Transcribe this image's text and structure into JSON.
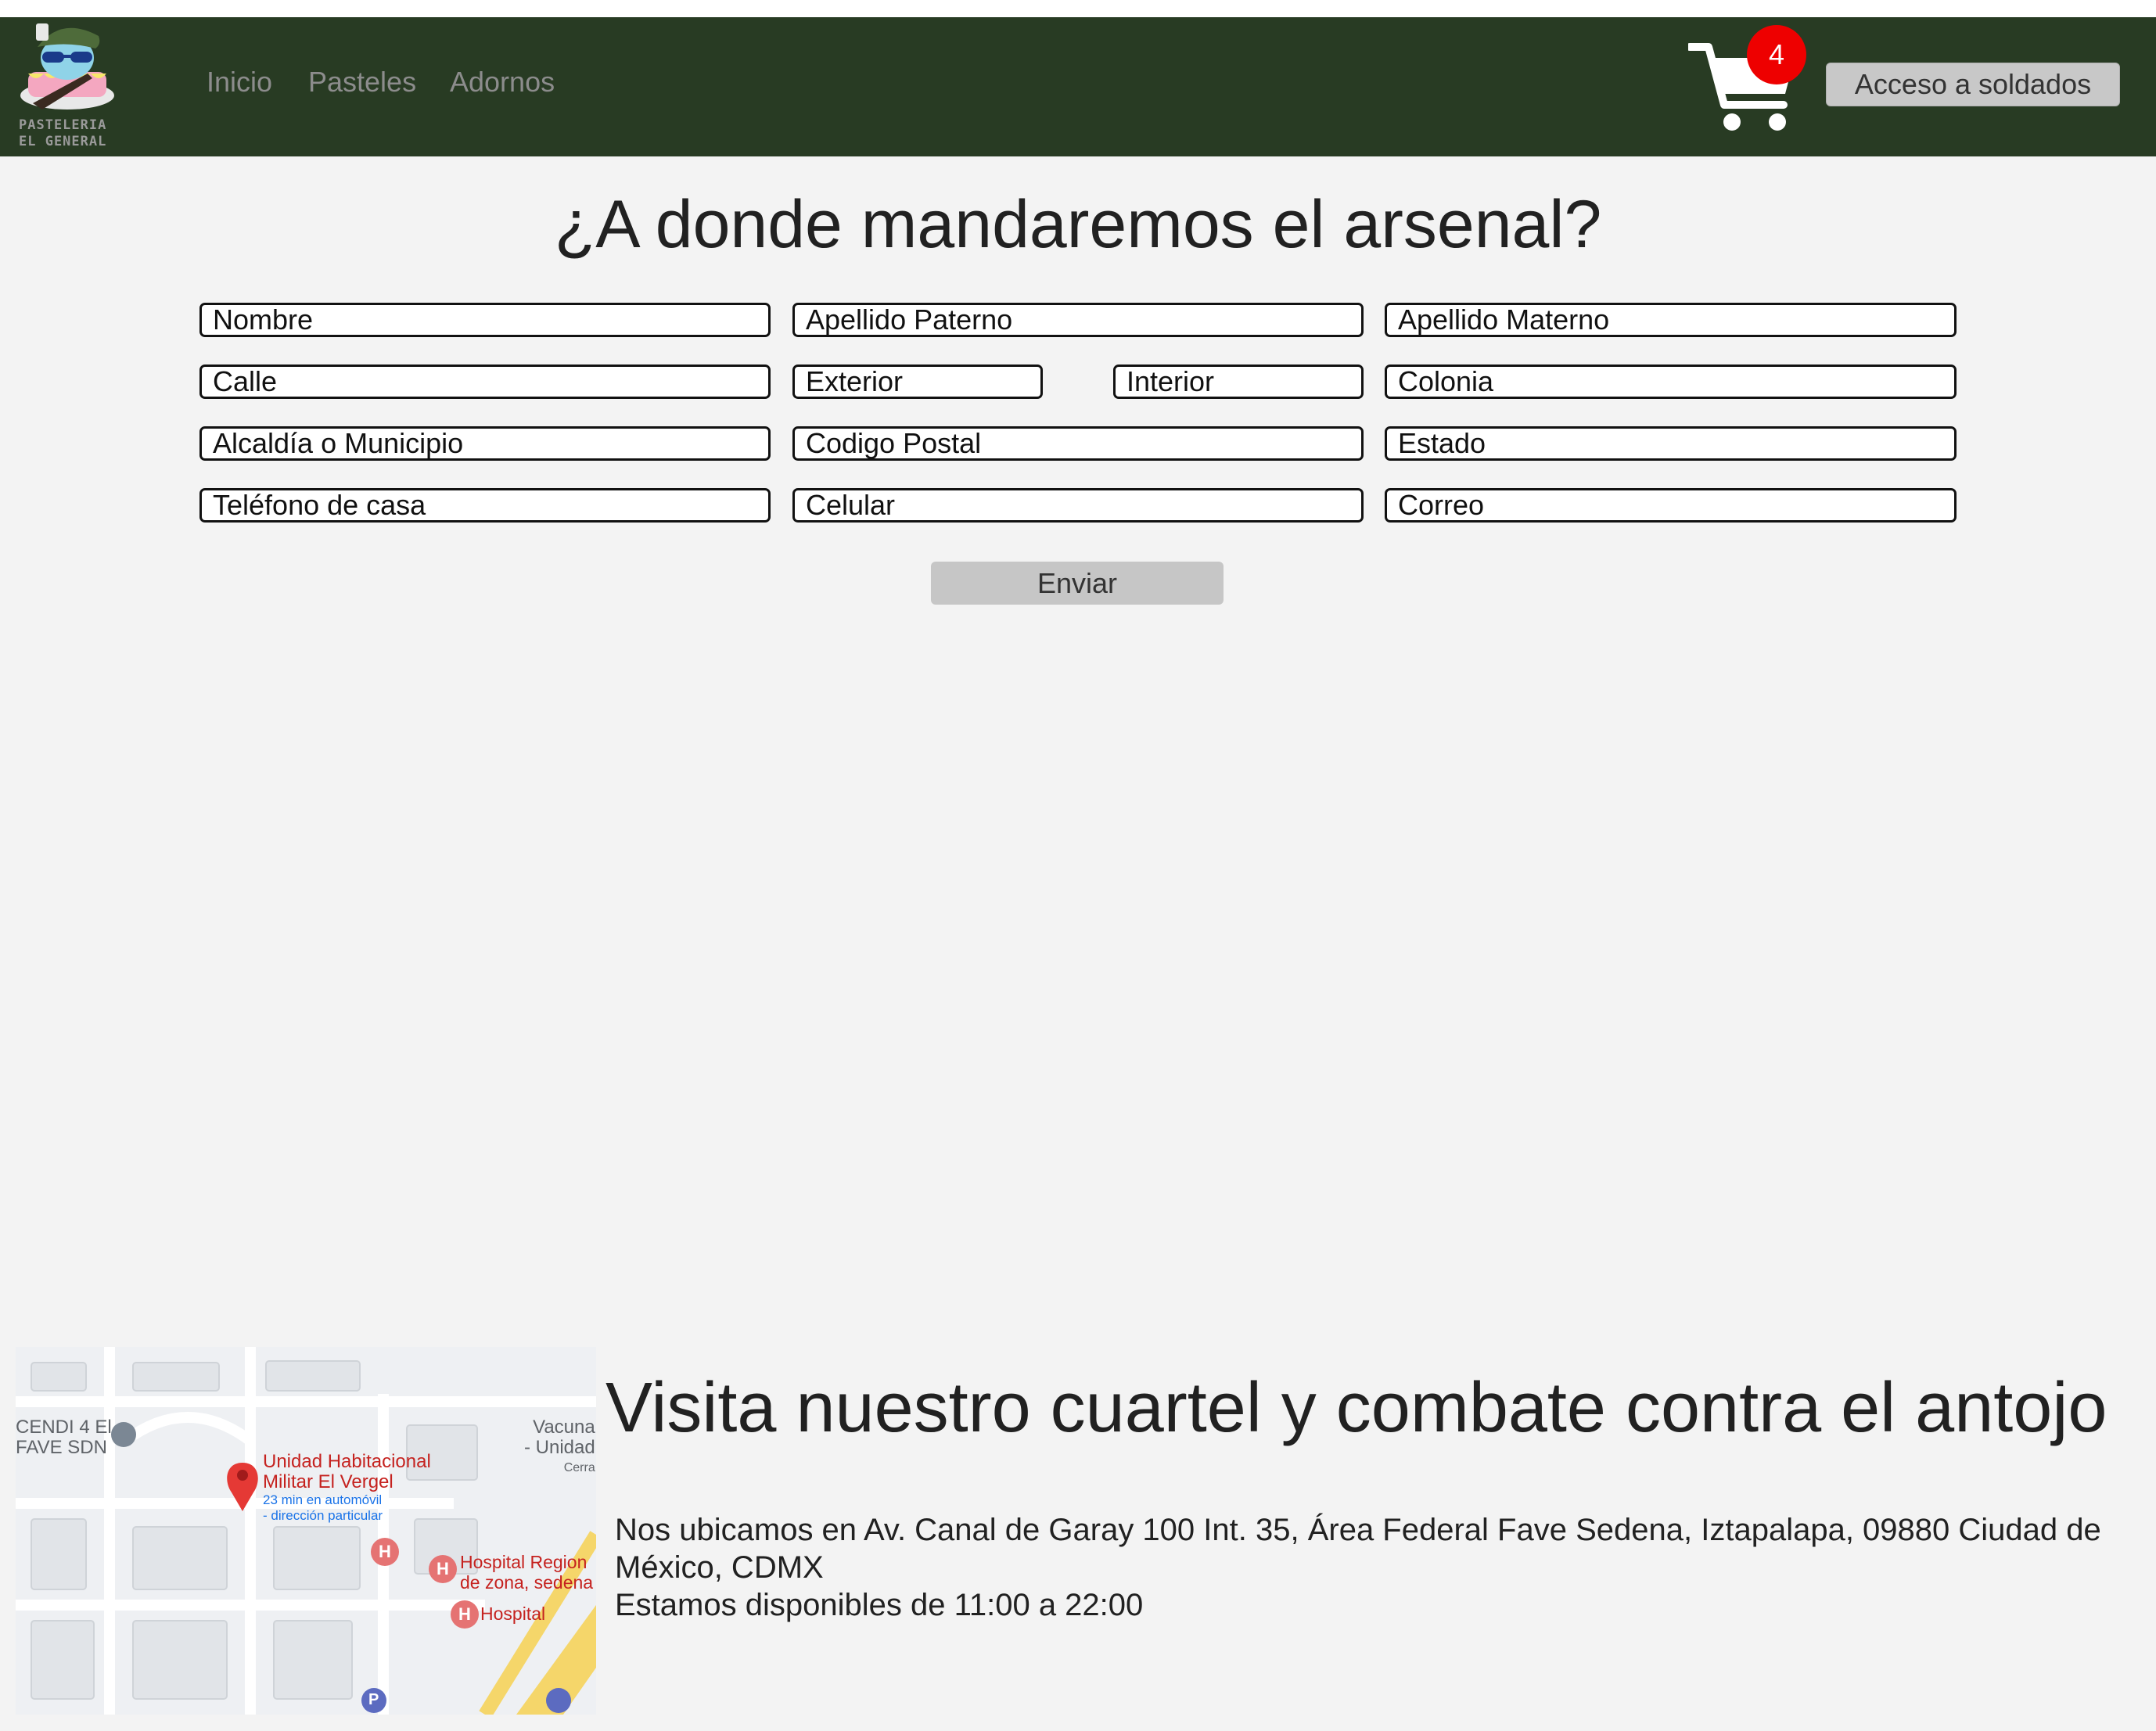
{
  "brand": {
    "logo_line1": "PASTELERIA",
    "logo_line2": "EL GENERAL"
  },
  "nav": {
    "links": [
      "Inicio",
      "Pasteles",
      "Adornos"
    ]
  },
  "cart": {
    "count": "4",
    "icon": "shopping-cart-icon"
  },
  "login": {
    "label": "Acceso a soldados"
  },
  "form": {
    "title": "¿A donde mandaremos el arsenal?",
    "placeholders": {
      "nombre": "Nombre",
      "apellido_paterno": "Apellido Paterno",
      "apellido_materno": "Apellido Materno",
      "calle": "Calle",
      "exterior": "Exterior",
      "interior": "Interior",
      "colonia": "Colonia",
      "alcaldia": "Alcaldía o Municipio",
      "codigo_postal": "Codigo Postal",
      "estado": "Estado",
      "telefono_casa": "Teléfono de casa",
      "celular": "Celular",
      "correo": "Correo"
    },
    "submit_label": "Enviar"
  },
  "footer": {
    "title": "Visita nuestro cuartel y combate contra el antojo",
    "address": "Nos ubicamos en Av. Canal de Garay 100 Int. 35, Área Federal Fave Sedena, Iztapalapa, 09880 Ciudad de México, CDMX",
    "hours": "Estamos disponibles de 11:00 a 22:00"
  },
  "map": {
    "labels": {
      "cendi_line1": "CENDI 4 El",
      "cendi_line2": "FAVE SDN",
      "vacuna_line1": "Vacuna",
      "vacuna_line2": "- Unidad",
      "vacuna_line3": "Cerra",
      "place_line1": "Unidad Habitacional",
      "place_line2": "Militar El Vergel",
      "place_line3": "23 min en automóvil",
      "place_line4": "- dirección particular",
      "hospital_region_line1": "Hospital Region",
      "hospital_region_line2": "de zona, sedena",
      "hospital": "Hospital",
      "hospital_letter": "H",
      "parking_letter": "P"
    }
  },
  "colors": {
    "navbar": "#283b23",
    "page_bg": "#f3f3f3",
    "badge": "#ee0000",
    "button": "#c8c8c8",
    "map_pin": "#e53935",
    "map_road": "#f5d66a"
  }
}
